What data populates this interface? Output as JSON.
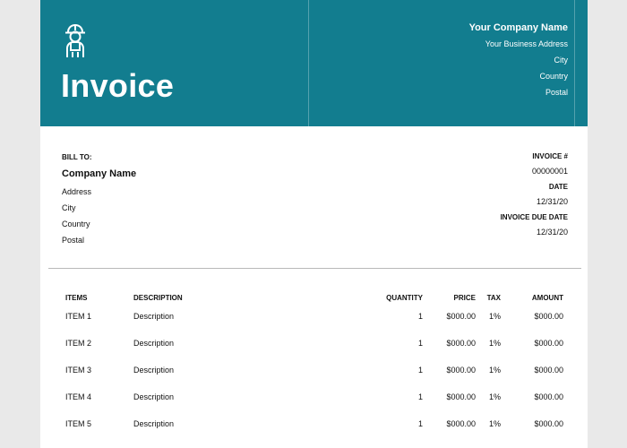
{
  "colors": {
    "header_background": "#127d8f",
    "page_background": "#ffffff",
    "outer_background": "#e9e9e9",
    "text_primary": "#111111",
    "divider": "#b8b8b8",
    "header_text": "#ffffff"
  },
  "header": {
    "icon": "construction-worker-icon",
    "title": "Invoice",
    "company": {
      "name": "Your Company Name",
      "lines": [
        "Your Business Address",
        "City",
        "Country",
        "Postal"
      ]
    }
  },
  "bill_to": {
    "label": "BILL TO:",
    "name": "Company Name",
    "lines": [
      "Address",
      "City",
      "Country",
      "Postal"
    ]
  },
  "invoice_meta": {
    "number_label": "INVOICE #",
    "number_value": "00000001",
    "date_label": "DATE",
    "date_value": "12/31/20",
    "due_date_label": "INVOICE DUE DATE",
    "due_date_value": "12/31/20"
  },
  "table": {
    "headers": {
      "items": "ITEMS",
      "description": "DESCRIPTION",
      "quantity": "QUANTITY",
      "price": "PRICE",
      "tax": "TAX",
      "amount": "AMOUNT"
    },
    "rows": [
      {
        "item": "ITEM 1",
        "description": "Description",
        "quantity": "1",
        "price": "$000.00",
        "tax": "1%",
        "amount": "$000.00"
      },
      {
        "item": "ITEM 2",
        "description": "Description",
        "quantity": "1",
        "price": "$000.00",
        "tax": "1%",
        "amount": "$000.00"
      },
      {
        "item": "ITEM 3",
        "description": "Description",
        "quantity": "1",
        "price": "$000.00",
        "tax": "1%",
        "amount": "$000.00"
      },
      {
        "item": "ITEM 4",
        "description": "Description",
        "quantity": "1",
        "price": "$000.00",
        "tax": "1%",
        "amount": "$000.00"
      },
      {
        "item": "ITEM 5",
        "description": "Description",
        "quantity": "1",
        "price": "$000.00",
        "tax": "1%",
        "amount": "$000.00"
      }
    ]
  }
}
